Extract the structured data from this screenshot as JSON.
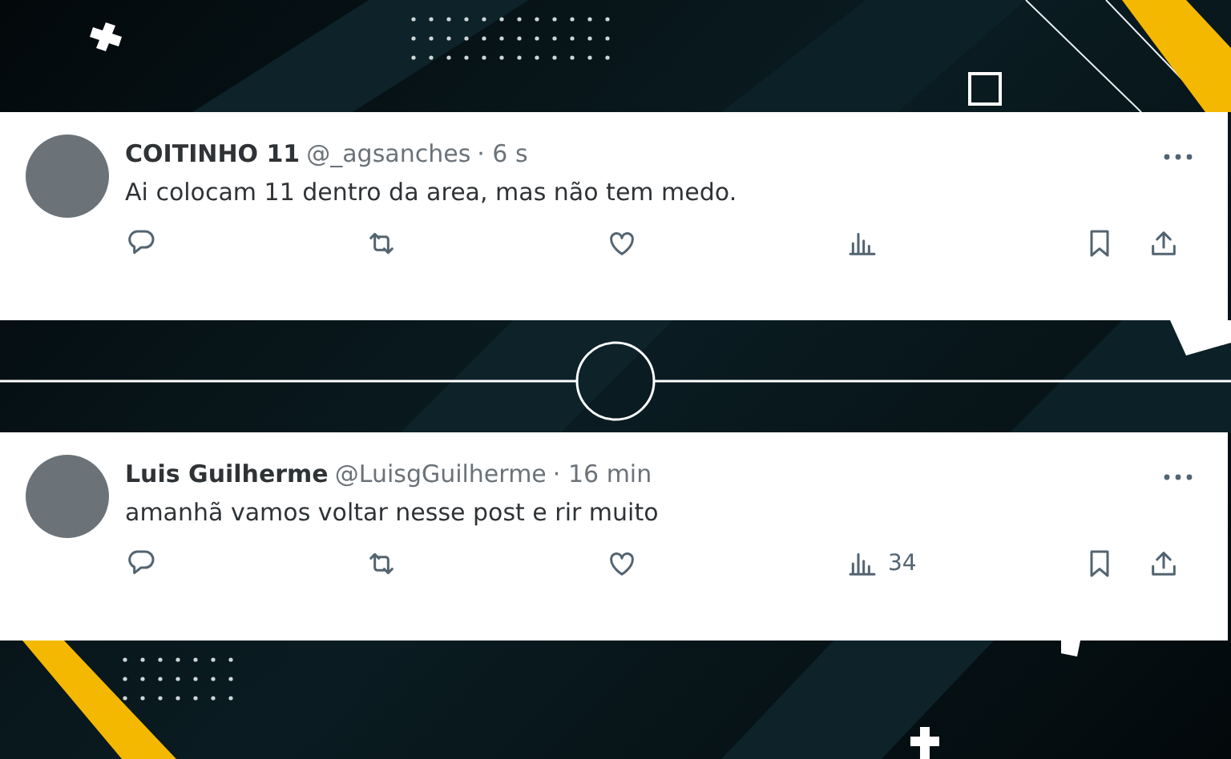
{
  "posts": [
    {
      "name": "COITINHO 11",
      "handle": "@_agsanches",
      "time": "· 6 s",
      "text": "Ai colocam 11 dentro da area, mas não tem medo."
    },
    {
      "name": "Luis Guilherme",
      "handle": "@LuisgGuilherme",
      "time": "· 16 min",
      "text": "amanhã vamos voltar nesse post e rir muito",
      "views": "34"
    }
  ]
}
